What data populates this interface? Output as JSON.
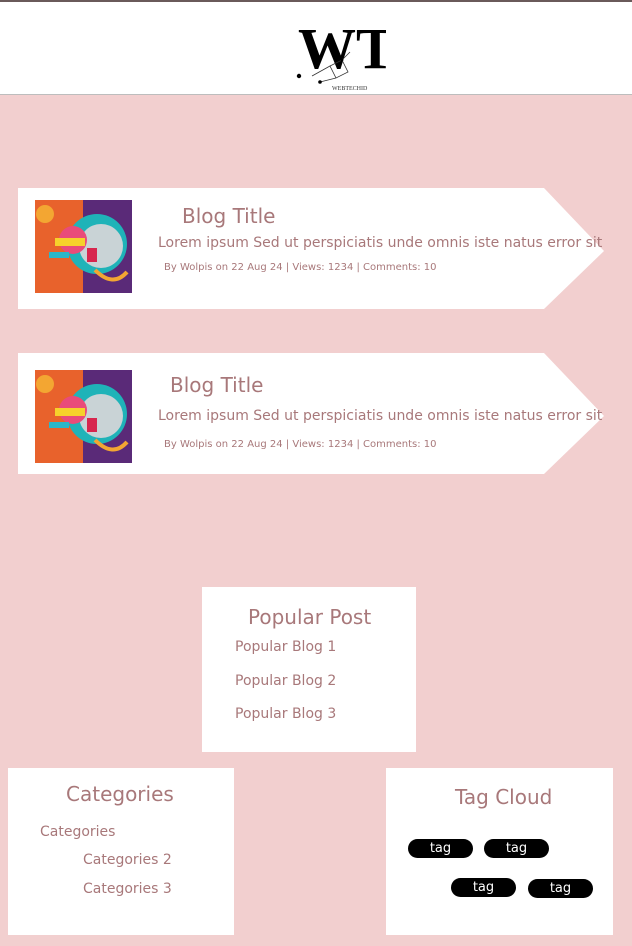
{
  "colors": {
    "page_background": "#f2cfcf",
    "card_background": "#ffffff",
    "text_accent": "#a8787a",
    "tag_background": "#000000",
    "tag_text": "#ffffff"
  },
  "header": {
    "logo_letters": "WT",
    "logo_caption": "WEBTECHID"
  },
  "posts": [
    {
      "title": "Blog Title",
      "excerpt": "Lorem ipsum  Sed ut perspiciatis unde omnis iste natus error sit",
      "meta": "By Wolpis on 22 Aug 24 | Views: 1234 | Comments: 10",
      "thumbnail_icon": "ai-head-illustration"
    },
    {
      "title": "Blog Title",
      "excerpt": "Lorem ipsum  Sed ut perspiciatis unde omnis iste natus error sit",
      "meta": "By Wolpis on 22 Aug 24 | Views: 1234 | Comments: 10",
      "thumbnail_icon": "ai-head-illustration"
    }
  ],
  "popular": {
    "title": "Popular Post",
    "items": [
      "Popular Blog 1",
      "Popular Blog 2",
      "Popular Blog 3"
    ]
  },
  "categories": {
    "title": "Categories",
    "items": [
      "Categories",
      "Categories 2",
      "Categories 3"
    ]
  },
  "tag_cloud": {
    "title": "Tag Cloud",
    "tags": [
      "tag",
      "tag",
      "tag",
      "tag"
    ]
  }
}
